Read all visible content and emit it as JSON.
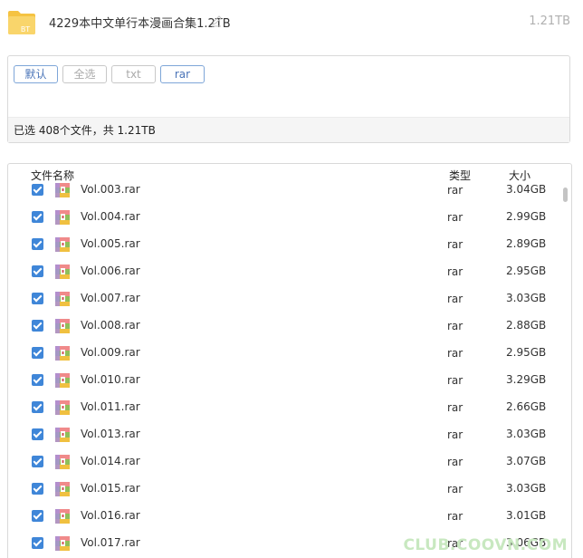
{
  "header": {
    "title": "4229本中文单行本漫画合集1.2TB",
    "total_size": "1.21TB",
    "folder_badge": "BT"
  },
  "filters": {
    "buttons": [
      {
        "label": "默认",
        "active": true
      },
      {
        "label": "全选",
        "active": false
      },
      {
        "label": "txt",
        "active": false
      },
      {
        "label": "rar",
        "active": true
      }
    ],
    "status": "已选 408个文件，共 1.21TB"
  },
  "file_list": {
    "columns": {
      "name": "文件名称",
      "type": "类型",
      "size": "大小"
    },
    "rows": [
      {
        "name": "Vol.003.rar",
        "type": "rar",
        "size": "3.04GB"
      },
      {
        "name": "Vol.004.rar",
        "type": "rar",
        "size": "2.99GB"
      },
      {
        "name": "Vol.005.rar",
        "type": "rar",
        "size": "2.89GB"
      },
      {
        "name": "Vol.006.rar",
        "type": "rar",
        "size": "2.95GB"
      },
      {
        "name": "Vol.007.rar",
        "type": "rar",
        "size": "3.03GB"
      },
      {
        "name": "Vol.008.rar",
        "type": "rar",
        "size": "2.88GB"
      },
      {
        "name": "Vol.009.rar",
        "type": "rar",
        "size": "2.95GB"
      },
      {
        "name": "Vol.010.rar",
        "type": "rar",
        "size": "3.29GB"
      },
      {
        "name": "Vol.011.rar",
        "type": "rar",
        "size": "2.66GB"
      },
      {
        "name": "Vol.013.rar",
        "type": "rar",
        "size": "3.03GB"
      },
      {
        "name": "Vol.014.rar",
        "type": "rar",
        "size": "3.07GB"
      },
      {
        "name": "Vol.015.rar",
        "type": "rar",
        "size": "3.03GB"
      },
      {
        "name": "Vol.016.rar",
        "type": "rar",
        "size": "3.01GB"
      },
      {
        "name": "Vol.017.rar",
        "type": "rar",
        "size": "3.06GB"
      }
    ]
  },
  "watermark": "CLUB.COOVN.COM",
  "colors": {
    "checkbox": "#3f86d8",
    "active_button_border": "#7ea6d8",
    "folder": "#f5c342"
  }
}
